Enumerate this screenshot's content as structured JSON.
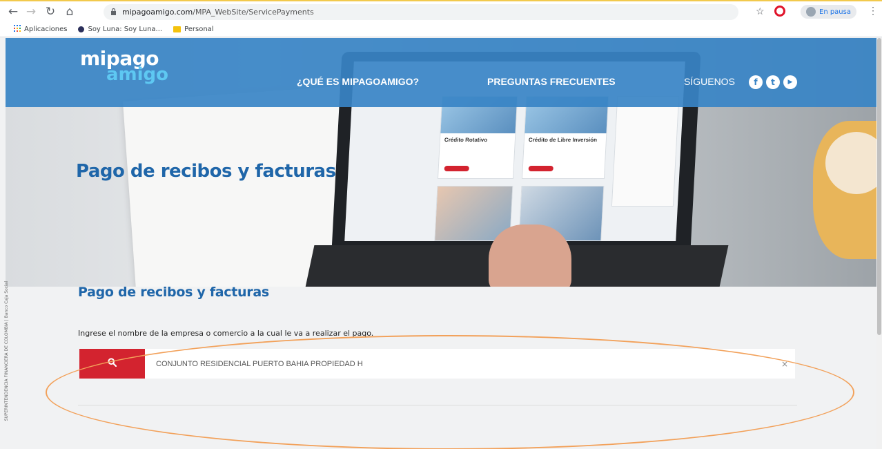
{
  "browser": {
    "url_host": "mipagoamigo.com",
    "url_path": "/MPA_WebSite/ServicePayments",
    "profile_label": "En pausa",
    "bookmarks": [
      {
        "label": "Aplicaciones",
        "icon": "apps-grid-icon"
      },
      {
        "label": "Soy Luna: Soy Luna...",
        "icon": "site-favicon"
      },
      {
        "label": "Personal",
        "icon": "folder-icon"
      }
    ]
  },
  "site": {
    "logo_top": "mipago",
    "logo_bottom": "amigo",
    "nav": {
      "about": "¿QUÉ ES MIPAGOAMIGO?",
      "faq": "PREGUNTAS FRECUENTES",
      "follow": "SÍGUENOS"
    },
    "social": [
      "f",
      "t",
      "▶"
    ],
    "hero_title": "Pago de recibos y facturas",
    "section_title": "Pago de recibos y facturas",
    "instruction": "Ingrese el nombre de la empresa o comercio a la cual le va a realizar el pago.",
    "search_value": "CONJUNTO RESIDENCIAL PUERTO BAHIA PROPIEDAD H",
    "clear_symbol": "×",
    "side_label": "SUPERINTENDENCIA FINANCIERA DE COLOMBIA | Banco Caja Social"
  },
  "colors": {
    "brand_blue": "#3884c6",
    "title_blue": "#1f66a9",
    "search_red": "#d3232f",
    "highlight_orange": "#f2a15a"
  }
}
